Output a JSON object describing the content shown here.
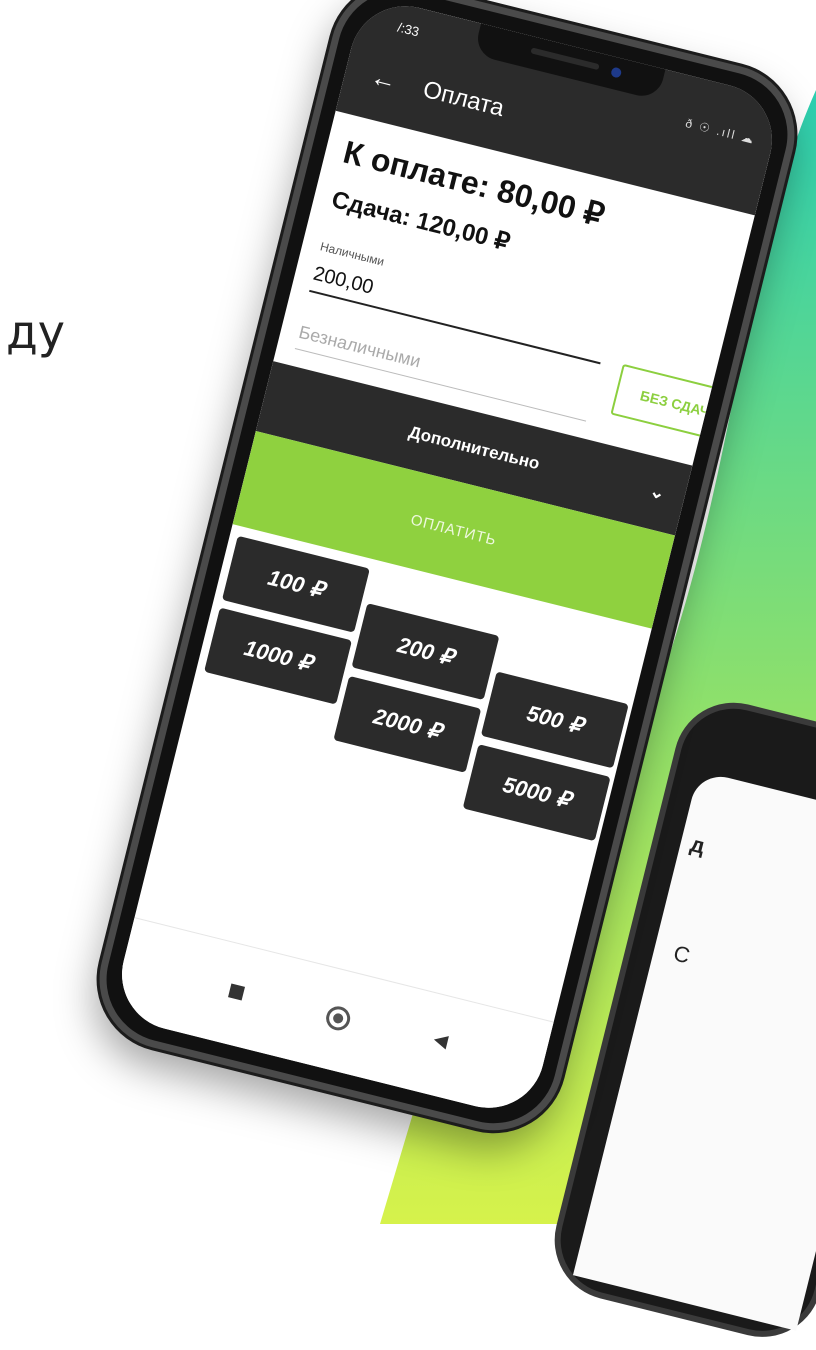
{
  "background": {
    "partial_word": "ду",
    "gradient_top": "#2ccfb1",
    "gradient_bottom": "#d6f24b"
  },
  "status_bar": {
    "time": "/:33",
    "icons": "ð ☉ .ıll ☁"
  },
  "app_bar": {
    "back_icon": "arrow-left-icon",
    "title": "Оплата"
  },
  "payment": {
    "to_pay": "К оплате: 80,00 ₽",
    "change": "Сдача: 120,00 ₽",
    "cash_label": "Наличными",
    "cash_value": "200,00",
    "card_placeholder": "Безналичными",
    "no_change_label": "БЕЗ СДАЧИ",
    "extra_label": "Дополнительно",
    "pay_label": "ОПЛАТИТЬ",
    "accent": "#8fd13f"
  },
  "amounts": [
    "100 ₽",
    "200 ₽",
    "500 ₽",
    "1000 ₽",
    "2000 ₽",
    "5000 ₽"
  ],
  "nav": {
    "recents_icon": "square-icon",
    "home_icon": "circle-icon",
    "back_icon": "triangle-back-icon"
  },
  "second_phone": {
    "chars": [
      "д",
      "C"
    ]
  }
}
